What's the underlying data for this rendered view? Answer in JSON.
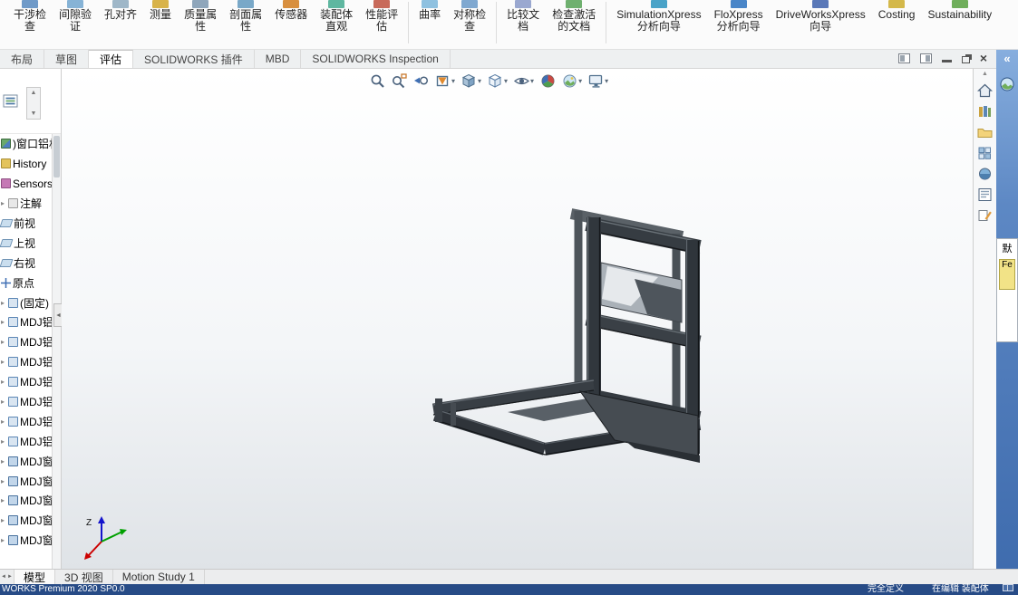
{
  "ribbon": {
    "items": [
      {
        "l1": "干涉检",
        "l2": "查"
      },
      {
        "l1": "间隙验",
        "l2": "证"
      },
      {
        "l1": "孔对齐",
        "l2": ""
      },
      {
        "l1": "测量",
        "l2": ""
      },
      {
        "l1": "质量属",
        "l2": "性"
      },
      {
        "l1": "剖面属",
        "l2": "性"
      },
      {
        "l1": "传感器",
        "l2": ""
      },
      {
        "l1": "装配体",
        "l2": "直观"
      },
      {
        "l1": "性能评",
        "l2": "估"
      },
      {
        "l1": "曲率",
        "l2": ""
      },
      {
        "l1": "对称检",
        "l2": "查"
      },
      {
        "l1": "比较文",
        "l2": "档"
      },
      {
        "l1": "检查激活",
        "l2": "的文档"
      },
      {
        "l1": "SimulationXpress",
        "l2": "分析向导"
      },
      {
        "l1": "FloXpress",
        "l2": "分析向导"
      },
      {
        "l1": "DriveWorksXpress",
        "l2": "向导"
      },
      {
        "l1": "Costing",
        "l2": ""
      },
      {
        "l1": "Sustainability",
        "l2": ""
      }
    ]
  },
  "command_tabs": {
    "items": [
      "布局",
      "草图",
      "评估",
      "SOLIDWORKS 插件",
      "MBD",
      "SOLIDWORKS Inspection"
    ],
    "active": "评估"
  },
  "feature_tree": {
    "items": [
      ")窗口铝材",
      "History",
      "Sensors",
      "注解",
      "前视",
      "上视",
      "右视",
      "原点",
      "(固定) M",
      "MDJ铝型",
      "MDJ铝型",
      "MDJ铝型",
      "MDJ铝型",
      "MDJ铝型",
      "MDJ铝型",
      "MDJ铝型",
      "MDJ窗口",
      "MDJ窗口",
      "MDJ窗口",
      "MDJ窗口",
      "MDJ窗口"
    ]
  },
  "viewport_toolbar": {
    "icons": [
      "zoom-to-fit",
      "zoom-to-area",
      "previous-view",
      "section-view",
      "view-orientation",
      "display-style",
      "hide-show-items",
      "edit-appearance",
      "apply-scene",
      "view-settings"
    ]
  },
  "task_pane": {
    "icons": [
      "solidworks-resources",
      "design-library",
      "file-explorer",
      "view-palette",
      "appearances-scenes",
      "custom-properties",
      "solidworks-forum"
    ],
    "collapse_chevron": "«",
    "flyout": {
      "header": "默",
      "swatch_label": "Fe"
    }
  },
  "triad": {
    "z": "Z"
  },
  "bottom_tabs": {
    "items": [
      "模型",
      "3D 视图",
      "Motion Study 1"
    ],
    "active": "模型"
  },
  "status_bar": {
    "product": "WORKS Premium 2020 SP0.0",
    "definition_state": "完全定义",
    "edit_mode": "在编辑 装配体"
  },
  "colors": {
    "status_bar_bg": "#274b86",
    "task_pane_strip": "#4a79bd",
    "swatch_yellow": "#f2e387",
    "model_metal_dark": "#33383d",
    "viewport_top": "#ffffff",
    "viewport_bottom": "#dfe3e7"
  }
}
